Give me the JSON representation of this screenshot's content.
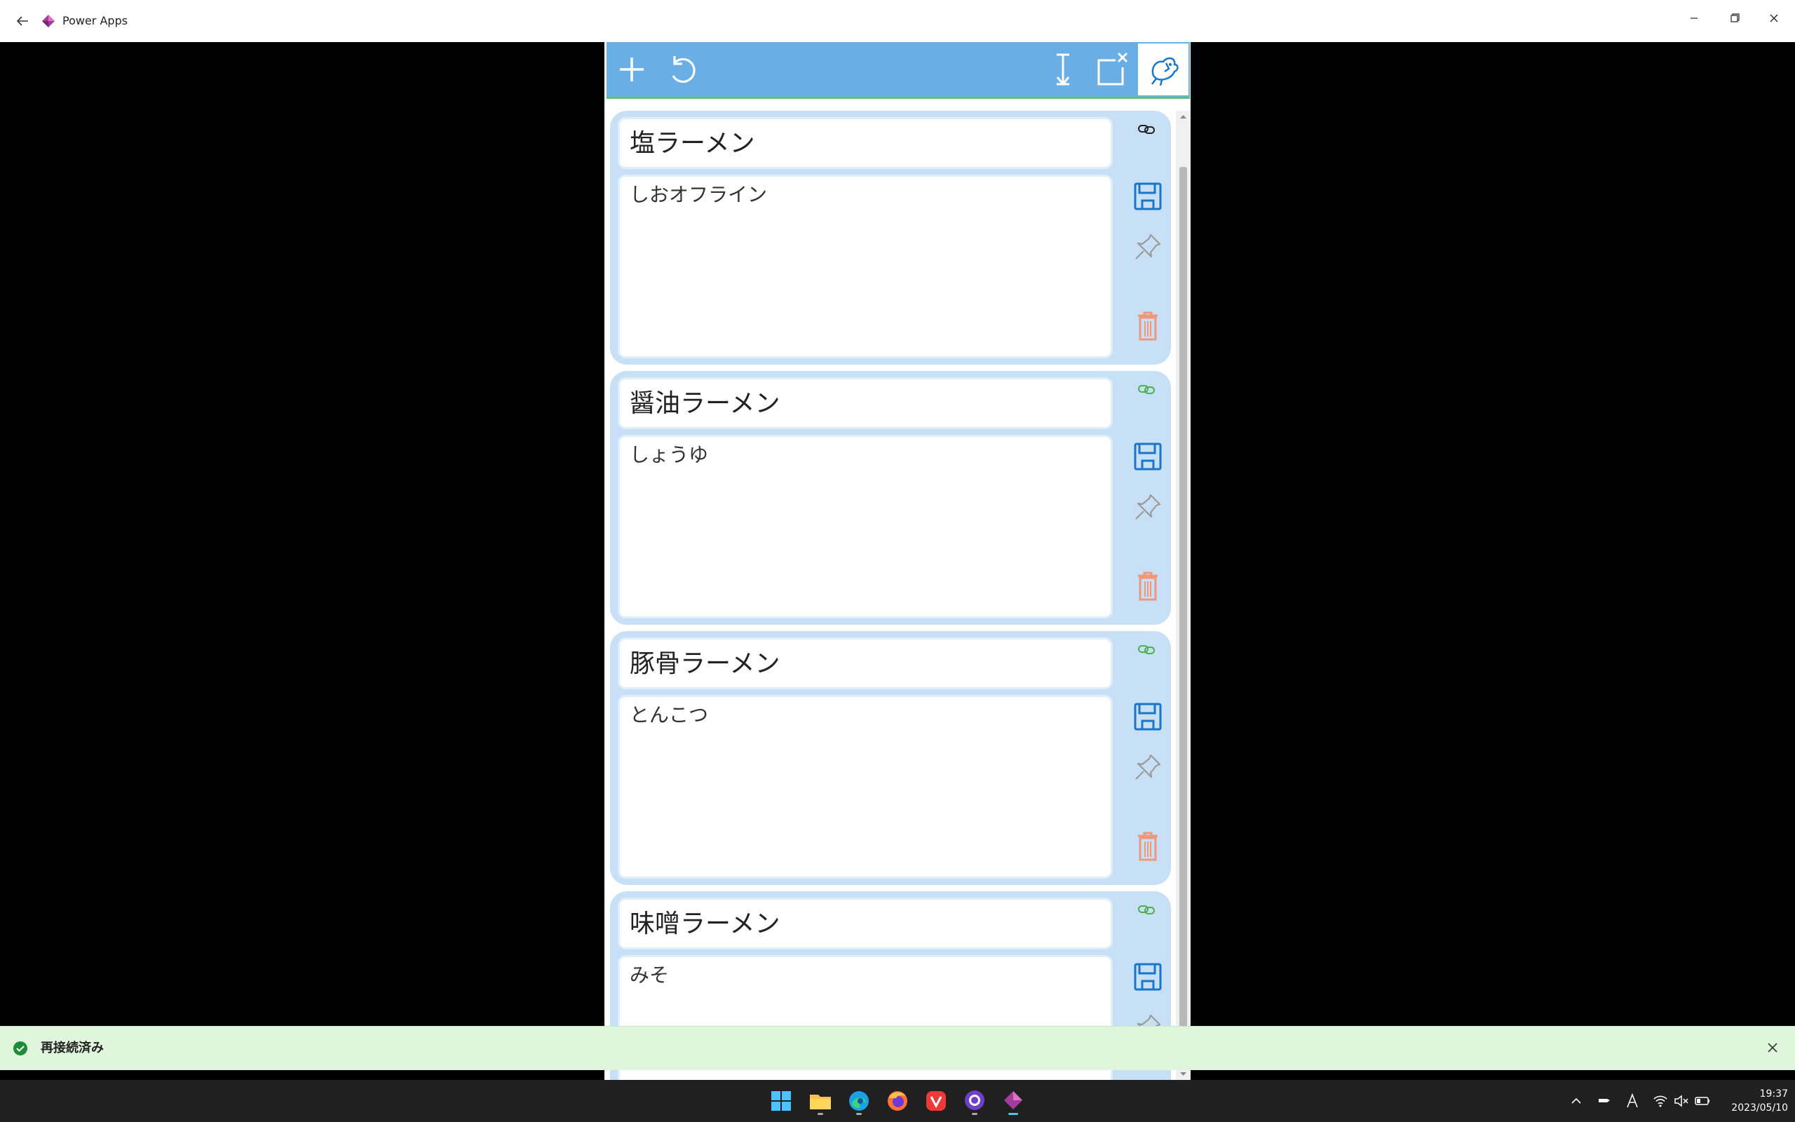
{
  "window": {
    "title": "Power Apps"
  },
  "colors": {
    "toolbar": "#6aaee6",
    "card": "#c8e0f5",
    "save": "#1976c9",
    "delete": "#f0977a",
    "pin": "#9a9a9a",
    "link_synced": "#4caf50",
    "link_default": "#222222",
    "toast_bg": "#dff6dd",
    "toast_icon": "#1e8b3a"
  },
  "toolbar": {
    "icons": [
      "add-icon",
      "undo-icon",
      "expand-vertical-icon",
      "close-window-icon",
      "power-apps-bird-icon"
    ]
  },
  "notes": [
    {
      "title": "塩ラーメン",
      "body": "しおオフライン",
      "link_icon": "link-icon",
      "link_state": "default"
    },
    {
      "title": "醤油ラーメン",
      "body": "しょうゆ",
      "link_icon": "link-icon",
      "link_state": "synced"
    },
    {
      "title": "豚骨ラーメン",
      "body": "とんこつ",
      "link_icon": "link-icon",
      "link_state": "synced"
    },
    {
      "title": "味噌ラーメン",
      "body": "みそ",
      "link_icon": "link-icon",
      "link_state": "synced"
    }
  ],
  "card_actions": [
    "save-icon",
    "pin-icon",
    "delete-icon"
  ],
  "toast": {
    "message": "再接続済み"
  },
  "taskbar": {
    "apps": [
      "windows-start-icon",
      "file-explorer-icon",
      "edge-icon",
      "firefox-icon",
      "vivaldi-icon",
      "github-desktop-icon",
      "power-apps-icon"
    ],
    "time": "19:37",
    "date": "2023/05/10"
  }
}
